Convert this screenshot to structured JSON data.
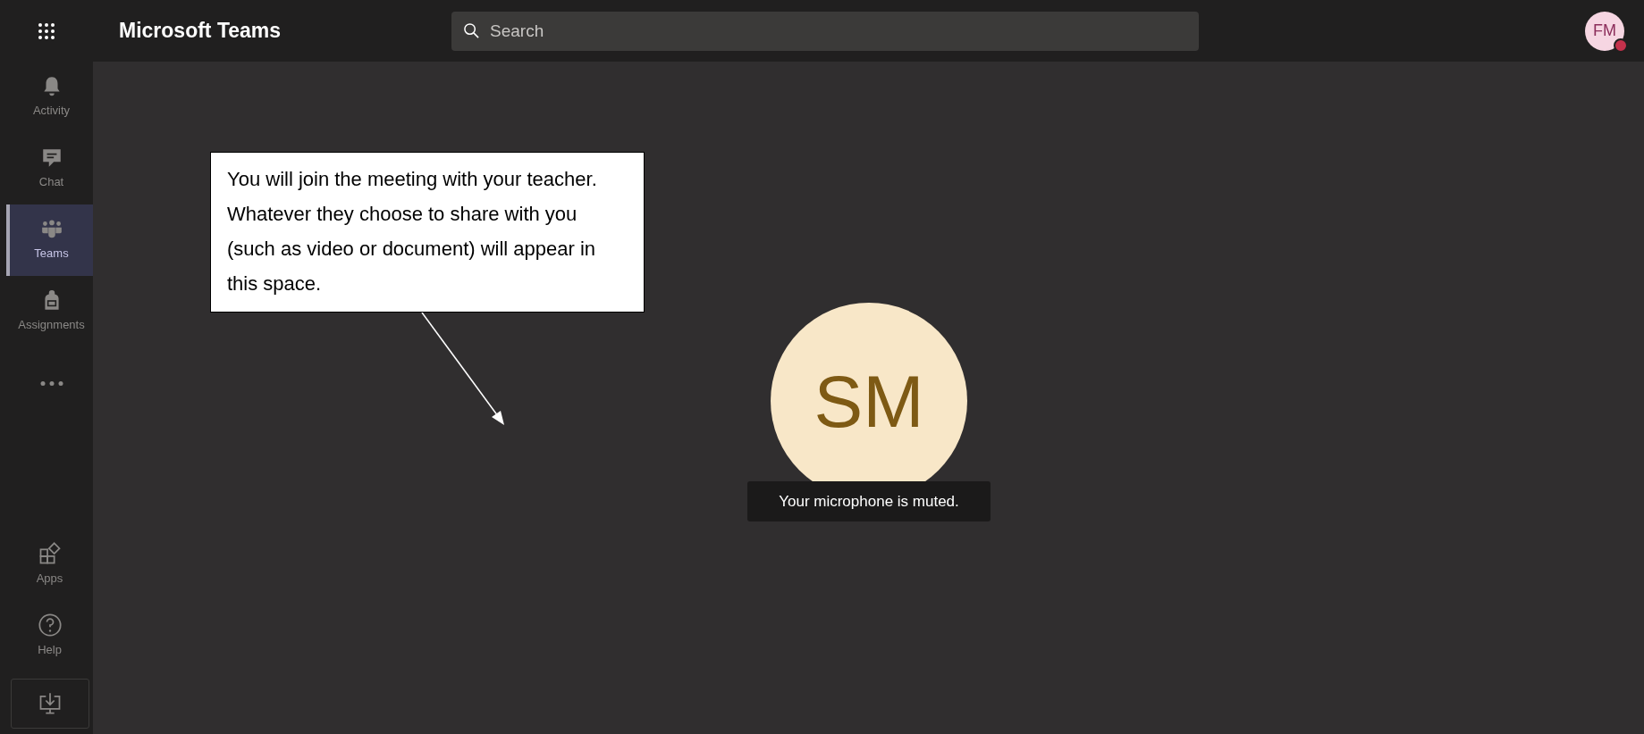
{
  "app": {
    "title": "Microsoft Teams"
  },
  "search": {
    "placeholder": "Search"
  },
  "profile": {
    "initials": "FM",
    "color": "#c4314b"
  },
  "sidebar": {
    "items": [
      {
        "kind": "bell",
        "label": "Activity",
        "selected": false
      },
      {
        "kind": "chat",
        "label": "Chat",
        "selected": false
      },
      {
        "kind": "teams",
        "label": "Teams",
        "selected": true
      },
      {
        "kind": "backpack",
        "label": "Assignments",
        "selected": false
      },
      {
        "kind": "more",
        "selected": false
      }
    ],
    "bottom_items": [
      {
        "kind": "apps",
        "label": "Apps"
      },
      {
        "kind": "help",
        "label": "Help"
      },
      {
        "kind": "download"
      }
    ]
  },
  "callout": {
    "text": "You will join the meeting with your teacher. Whatever they choose to share with you (such as video or document) will appear in this space."
  },
  "participant": {
    "initials": "SM"
  },
  "toast": {
    "text": "Your microphone is muted."
  }
}
